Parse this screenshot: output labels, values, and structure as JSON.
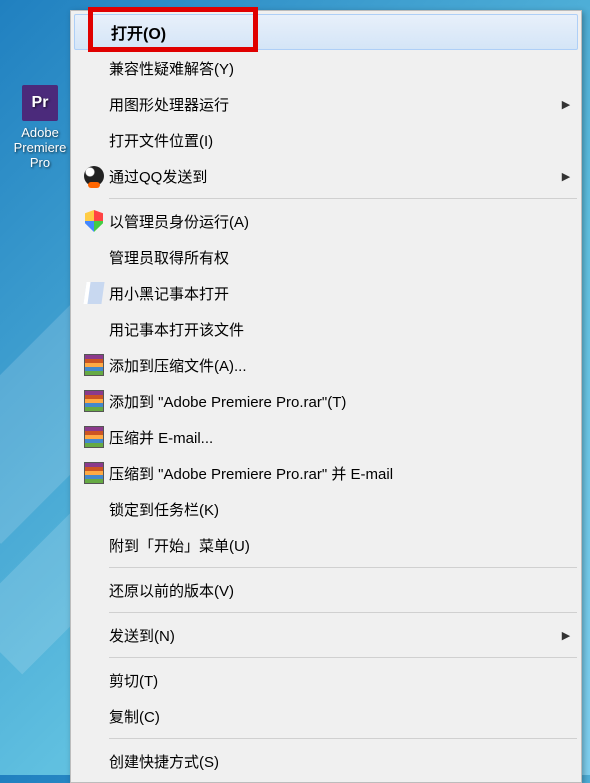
{
  "desktop": {
    "app_name": "Adobe Premiere Pro",
    "app_name_short": "Pr"
  },
  "menu": {
    "items": [
      {
        "label": "打开(O)",
        "bold": true,
        "highlighted": true,
        "icon": null,
        "submenu": false
      },
      {
        "label": "兼容性疑难解答(Y)",
        "icon": null,
        "submenu": false
      },
      {
        "label": "用图形处理器运行",
        "icon": null,
        "submenu": true
      },
      {
        "label": "打开文件位置(I)",
        "icon": null,
        "submenu": false
      },
      {
        "label": "通过QQ发送到",
        "icon": "qq",
        "submenu": true
      },
      {
        "sep": true
      },
      {
        "label": "以管理员身份运行(A)",
        "icon": "shield",
        "submenu": false
      },
      {
        "label": "管理员取得所有权",
        "icon": null,
        "submenu": false
      },
      {
        "label": "用小黑记事本打开",
        "icon": "notebook",
        "submenu": false
      },
      {
        "label": "用记事本打开该文件",
        "icon": null,
        "submenu": false
      },
      {
        "label": "添加到压缩文件(A)...",
        "icon": "rar",
        "submenu": false
      },
      {
        "label": "添加到 \"Adobe Premiere Pro.rar\"(T)",
        "icon": "rar",
        "submenu": false
      },
      {
        "label": "压缩并 E-mail...",
        "icon": "rar",
        "submenu": false
      },
      {
        "label": "压缩到 \"Adobe Premiere Pro.rar\" 并 E-mail",
        "icon": "rar",
        "submenu": false
      },
      {
        "label": "锁定到任务栏(K)",
        "icon": null,
        "submenu": false
      },
      {
        "label": "附到「开始」菜单(U)",
        "icon": null,
        "submenu": false
      },
      {
        "sep": true
      },
      {
        "label": "还原以前的版本(V)",
        "icon": null,
        "submenu": false
      },
      {
        "sep": true
      },
      {
        "label": "发送到(N)",
        "icon": null,
        "submenu": true
      },
      {
        "sep": true
      },
      {
        "label": "剪切(T)",
        "icon": null,
        "submenu": false
      },
      {
        "label": "复制(C)",
        "icon": null,
        "submenu": false
      },
      {
        "sep": true
      },
      {
        "label": "创建快捷方式(S)",
        "icon": null,
        "submenu": false
      }
    ]
  }
}
